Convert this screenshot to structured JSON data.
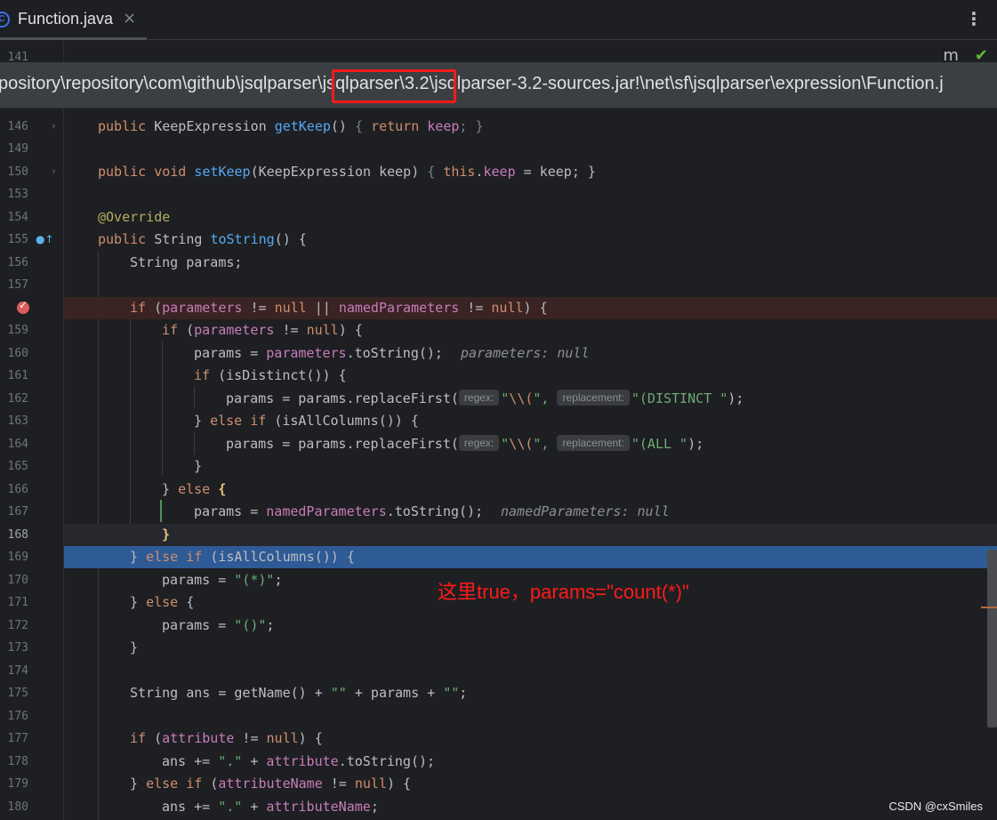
{
  "tab": {
    "icon_letter": "C",
    "title": "Function.java",
    "close": "×"
  },
  "menu_glyph": "⋮",
  "topicons": {
    "m": "m",
    "check": "✔"
  },
  "ghost_line_number": "141",
  "path": "pository\\repository\\com\\github\\jsqlparser\\jsqlparser\\3.2\\jsqlparser-3.2-sources.jar!\\net\\sf\\jsqlparser\\expression\\Function.j",
  "annotation": "这里true，params=\"count(*)\"",
  "watermark": "CSDN @cxSmiles",
  "lines": [
    {
      "n": "146"
    },
    {
      "n": "149"
    },
    {
      "n": "150"
    },
    {
      "n": "153"
    },
    {
      "n": "154"
    },
    {
      "n": "155"
    },
    {
      "n": "156"
    },
    {
      "n": "157"
    },
    {
      "n": "158"
    },
    {
      "n": "159"
    },
    {
      "n": "160"
    },
    {
      "n": "161"
    },
    {
      "n": "162"
    },
    {
      "n": "163"
    },
    {
      "n": "164"
    },
    {
      "n": "165"
    },
    {
      "n": "166"
    },
    {
      "n": "167"
    },
    {
      "n": "168"
    },
    {
      "n": "169"
    },
    {
      "n": "170"
    },
    {
      "n": "171"
    },
    {
      "n": "172"
    },
    {
      "n": "173"
    },
    {
      "n": "174"
    },
    {
      "n": "175"
    },
    {
      "n": "176"
    },
    {
      "n": "177"
    },
    {
      "n": "178"
    },
    {
      "n": "179"
    },
    {
      "n": "180"
    }
  ],
  "code": {
    "l146": {
      "a": "public ",
      "b": "KeepExpression ",
      "c": "getKeep",
      "d": "() ",
      "e": "{ ",
      "f": "return ",
      "g": "keep",
      "h": "; }"
    },
    "l150": {
      "a": "public void ",
      "c": "setKeep",
      "d": "(KeepExpression keep) ",
      "e": "{ ",
      "f": "this",
      ".": ".",
      "g": "keep",
      "h": " = keep; }"
    },
    "l154": {
      "a": "@Override"
    },
    "l155": {
      "a": "public ",
      "b": "String ",
      "c": "toString",
      "d": "() {"
    },
    "l156": {
      "a": "String params;"
    },
    "l158": {
      "a": "if ",
      "b": "(",
      "c": "parameters",
      "d": " != ",
      "e": "null",
      "f": " || ",
      "g": "namedParameters",
      "h": " != ",
      "i": "null",
      "j": ") {"
    },
    "l159": {
      "a": "if ",
      "b": "(",
      "c": "parameters",
      "d": " != ",
      "e": "null",
      "f": ") {"
    },
    "l160": {
      "a": "params = ",
      "b": "parameters",
      ".": ".toString();",
      "h": "parameters: null"
    },
    "l161": {
      "a": "if ",
      "b": "(isDistinct()) {"
    },
    "l162": {
      "a": "params = params.replaceFirst(",
      "p1": "regex:",
      "s1": "\"",
      "e1": "\\\\(",
      "s1b": "\",",
      "p2": "replacement:",
      "s2": "\"(DISTINCT \"",
      "z": ");"
    },
    "l163": {
      "a": "} ",
      "b": "else if ",
      "c": "(isAllColumns()) {"
    },
    "l164": {
      "a": "params = params.replaceFirst(",
      "p1": "regex:",
      "s1": "\"",
      "e1": "\\\\(",
      "s1b": "\",",
      "p2": "replacement:",
      "s2": "\"(ALL \"",
      "z": ");"
    },
    "l165": {
      "a": "}"
    },
    "l166": {
      "a": "} ",
      "b": "else ",
      "c": "{"
    },
    "l167": {
      "a": "params = ",
      "b": "namedParameters",
      "c": ".toString();",
      "h": "namedParameters: null"
    },
    "l168": {
      "a": "}"
    },
    "l169": {
      "a": "} ",
      "b": "else if ",
      "c": "(isAllColumns()) {"
    },
    "l170": {
      "a": "params = ",
      "s": "\"(*)\"",
      "z": ";"
    },
    "l171": {
      "a": "} ",
      "b": "else ",
      "c": "{"
    },
    "l172": {
      "a": "params = ",
      "s": "\"()\"",
      "z": ";"
    },
    "l173": {
      "a": "}"
    },
    "l175": {
      "a": "String ans = getName() + ",
      "s1": "\"\"",
      "m": " + params + ",
      "s2": "\"\"",
      "z": ";"
    },
    "l177": {
      "a": "if ",
      "b": "(",
      "c": "attribute",
      "d": " != ",
      "e": "null",
      "f": ") {"
    },
    "l178": {
      "a": "ans += ",
      "s": "\".\"",
      "m": " + ",
      "c": "attribute",
      "z": ".toString();"
    },
    "l179": {
      "a": "} ",
      "b": "else if ",
      "c": "(",
      "d": "attributeName",
      "e": " != ",
      "f": "null",
      "g": ") {"
    },
    "l180": {
      "a": "ans += ",
      "s": "\".\"",
      "m": " + ",
      "c": "attributeName",
      "z": ";"
    }
  }
}
